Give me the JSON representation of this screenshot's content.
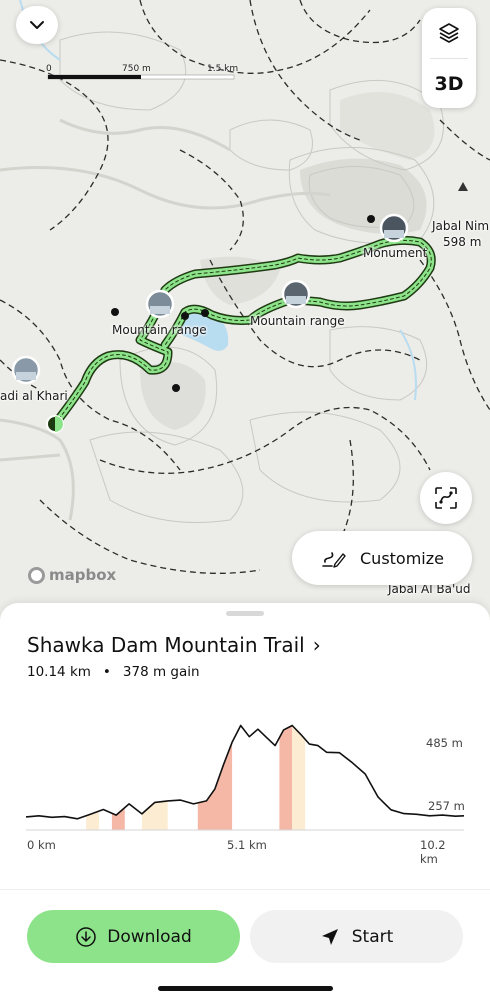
{
  "map": {
    "scale": {
      "zero": "0",
      "mid": "750 m",
      "max": "1.5 km"
    },
    "labels": {
      "peak_name": "Jabal Nim",
      "peak_elev": "598 m",
      "monument": "Monument",
      "mountain_range_1": "Mountain range",
      "mountain_range_2": "Mountain range",
      "wadi": "adi al Khari",
      "jabal_baud": "Jabal Al Ba'ud"
    },
    "attribution": "mapbox",
    "buttons": {
      "three_d": "3D",
      "customize": "Customize"
    },
    "colors": {
      "trail": "#7fd36b",
      "trail_dark": "#1e3a12",
      "water": "#b8dcf0"
    }
  },
  "trail": {
    "title": "Shawka Dam Mountain Trail",
    "chevron": "›",
    "distance": "10.14 km",
    "separator": "•",
    "gain": "378 m gain"
  },
  "chart_data": {
    "type": "area",
    "xlabel": "",
    "ylabel": "",
    "x_ticks": [
      "0 km",
      "5.1 km",
      "10.2 km"
    ],
    "y_ticks": [
      "485 m",
      "257 m"
    ],
    "xlim": [
      0,
      10.2
    ],
    "ylim": [
      220,
      520
    ],
    "x": [
      0,
      0.3,
      0.6,
      0.9,
      1.2,
      1.5,
      1.8,
      2.1,
      2.4,
      2.7,
      3.0,
      3.3,
      3.6,
      3.9,
      4.2,
      4.4,
      4.6,
      4.8,
      5.0,
      5.2,
      5.4,
      5.6,
      5.8,
      6.0,
      6.2,
      6.4,
      6.6,
      6.8,
      7.0,
      7.3,
      7.6,
      7.9,
      8.2,
      8.5,
      8.8,
      9.1,
      9.4,
      9.7,
      10.0,
      10.2
    ],
    "y": [
      255,
      258,
      254,
      256,
      250,
      262,
      275,
      260,
      290,
      263,
      294,
      298,
      300,
      290,
      298,
      330,
      395,
      455,
      500,
      470,
      490,
      468,
      446,
      488,
      500,
      476,
      450,
      446,
      428,
      427,
      400,
      370,
      308,
      274,
      264,
      262,
      258,
      260,
      257,
      258
    ],
    "highlight_segments": [
      {
        "from": 1.4,
        "to": 1.7,
        "color": "#fcecd2"
      },
      {
        "from": 2.0,
        "to": 2.3,
        "color": "#f6b8a6"
      },
      {
        "from": 2.7,
        "to": 3.3,
        "color": "#fcecd2"
      },
      {
        "from": 4.0,
        "to": 4.8,
        "color": "#f6b8a6"
      },
      {
        "from": 5.9,
        "to": 6.2,
        "color": "#f6b8a6"
      },
      {
        "from": 6.2,
        "to": 6.5,
        "color": "#fcecd2"
      }
    ]
  },
  "footer": {
    "download": "Download",
    "start": "Start"
  }
}
